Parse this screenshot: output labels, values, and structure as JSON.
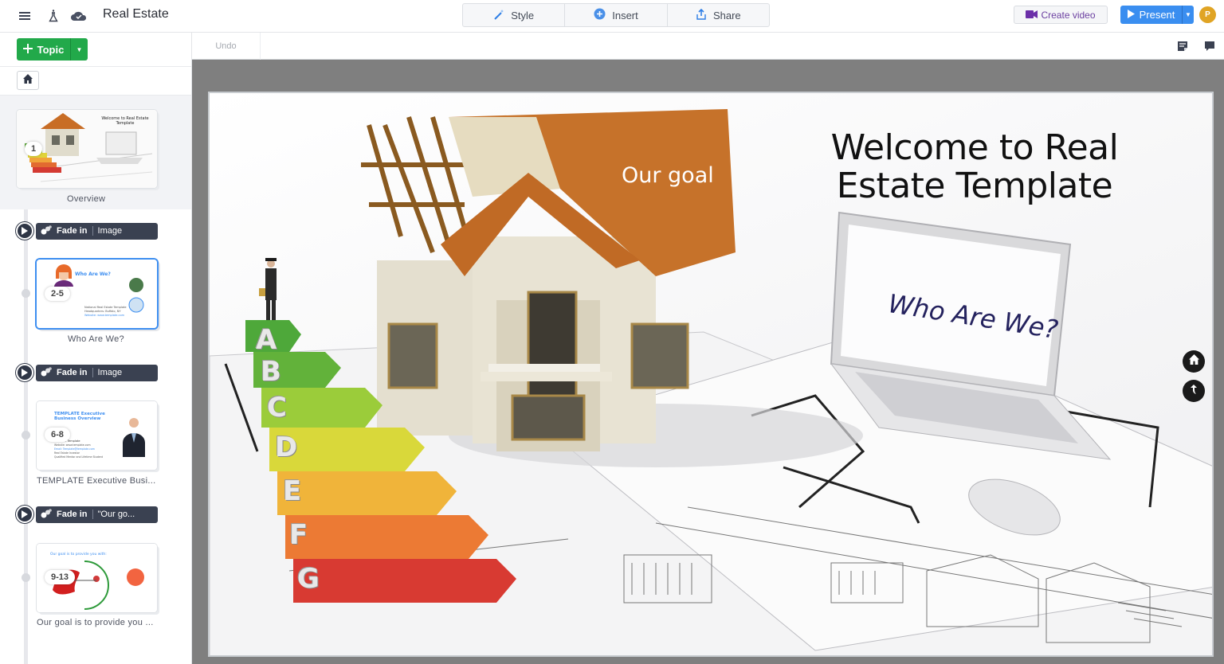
{
  "header": {
    "app_title": "Real Estate",
    "icons": [
      "menu-icon",
      "lab-flask-icon",
      "cloud-saved-icon"
    ],
    "center_tabs": [
      {
        "label": "Style",
        "icon": "magic-wand-icon"
      },
      {
        "label": "Insert",
        "icon": "plus-circle-icon"
      },
      {
        "label": "Share",
        "icon": "share-upload-icon"
      }
    ],
    "create_video_label": "Create video",
    "present_label": "Present",
    "avatar_initial": "P",
    "colors": {
      "present": "#3a8ef0",
      "create_video_text": "#6b3fa0",
      "avatar": "#e0a424"
    }
  },
  "sidebar": {
    "topic_button_label": "Topic",
    "topic_button_color": "#22a94a",
    "items": [
      {
        "type": "topic",
        "label": "Overview",
        "badge": "1",
        "thumb_title": "Welcome to Real Estate Template"
      },
      {
        "type": "transition",
        "effect": "Fade in",
        "target": "Image"
      },
      {
        "type": "topic",
        "label": "Who Are We?",
        "badge": "2-5",
        "active": true,
        "thumb_title": "Who Are We?",
        "thumb_lines": [
          "National Real Estate Template",
          "Headquarters: Buffalo, NY",
          "Website: www.template.com"
        ]
      },
      {
        "type": "transition",
        "effect": "Fade in",
        "target": "Image"
      },
      {
        "type": "topic",
        "label": "TEMPLATE Executive Busi...",
        "badge": "6-8",
        "thumb_title": "TEMPLATE Executive Business Overview",
        "thumb_lines": [
          "A. Template",
          "Website: www.template.com",
          "Email: Template@template.com"
        ]
      },
      {
        "type": "transition",
        "effect": "Fade in",
        "target": "\"Our go..."
      },
      {
        "type": "topic",
        "label": "Our goal is to provide you ...",
        "badge": "9-13",
        "thumb_title": "Our goal is to provide you with:"
      }
    ]
  },
  "toolbar": {
    "undo_label": "Undo",
    "right_icons": [
      "notes-icon",
      "comment-icon"
    ]
  },
  "slide": {
    "title": "Welcome to Real Estate Template",
    "our_goal_label": "Our goal",
    "who_are_we_label": "Who Are We?",
    "energy_labels": [
      "A",
      "B",
      "C",
      "D",
      "E",
      "F",
      "G"
    ],
    "energy_colors": [
      "#4ea83a",
      "#62b23a",
      "#9bcc3a",
      "#d9d83a",
      "#f0b43a",
      "#ec7a34",
      "#d83a32"
    ],
    "nav_icons": [
      "home-icon",
      "back-icon"
    ]
  }
}
